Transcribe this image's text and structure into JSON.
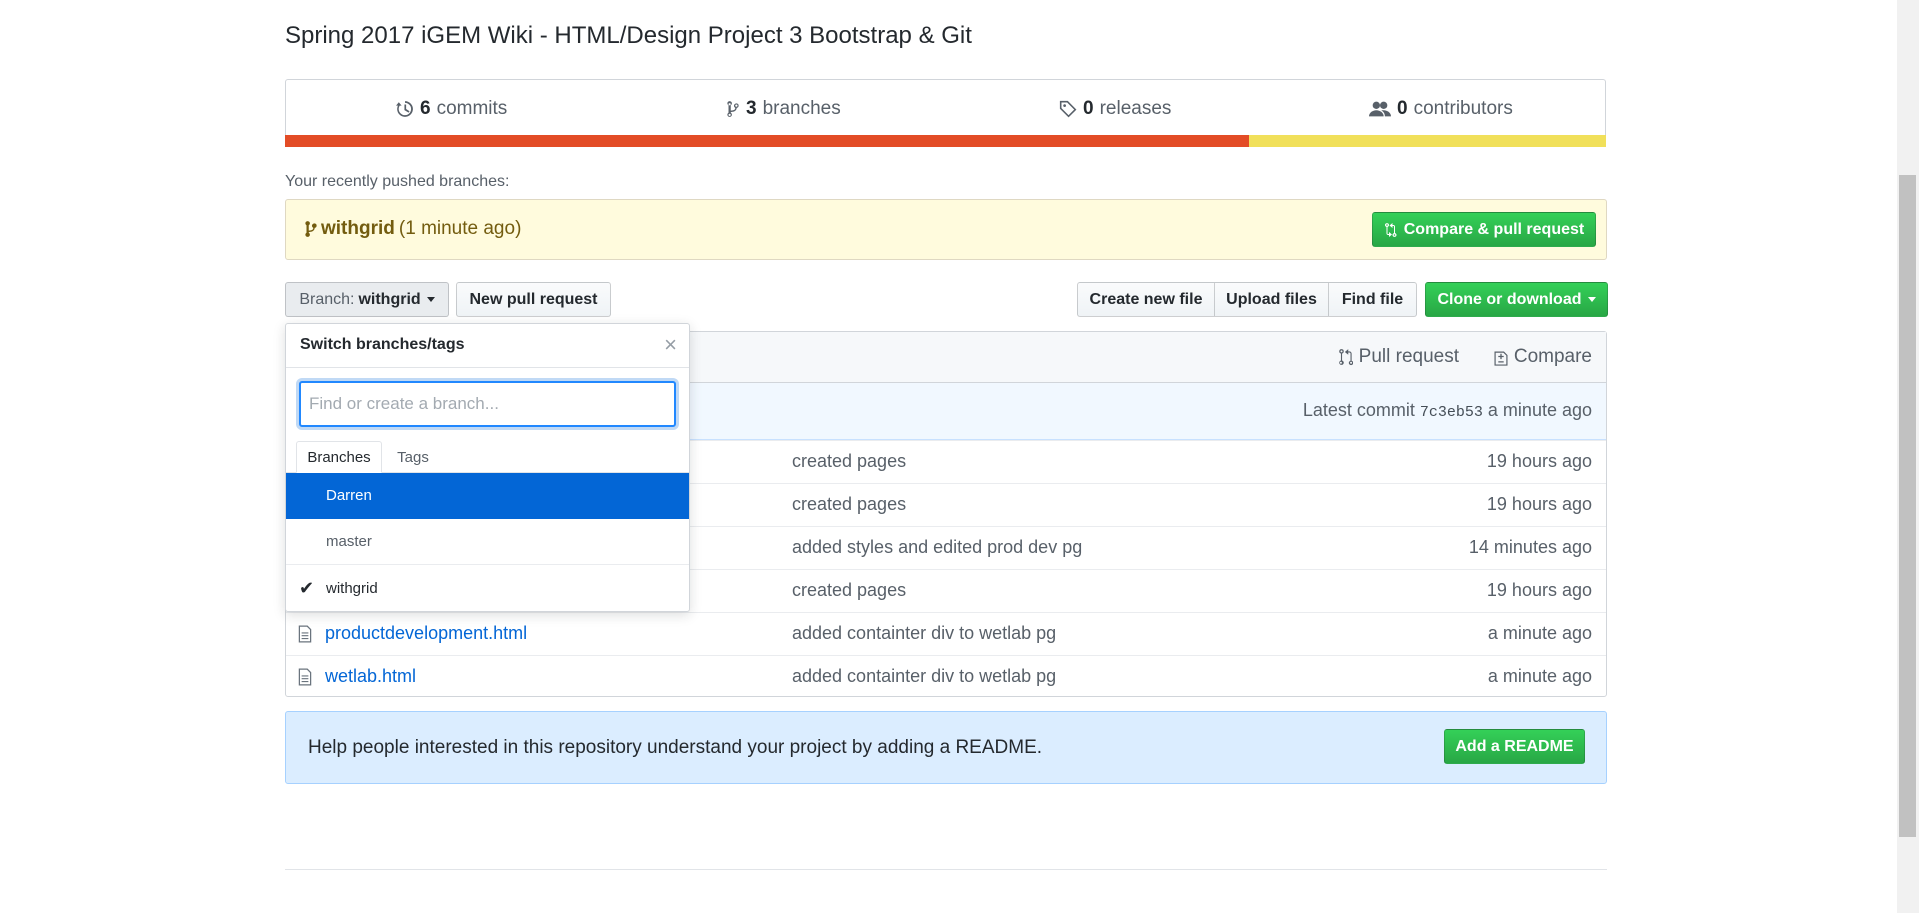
{
  "repo": {
    "description": "Spring 2017 iGEM Wiki - HTML/Design Project 3 Bootstrap & Git"
  },
  "summary": {
    "commits": {
      "count": "6",
      "label": "commits"
    },
    "branches": {
      "count": "3",
      "label": "branches"
    },
    "releases": {
      "count": "0",
      "label": "releases"
    },
    "contributors": {
      "count": "0",
      "label": "contributors"
    },
    "languages": [
      {
        "color": "#e34c26",
        "share": 0.73
      },
      {
        "color": "#f1e05a",
        "share": 0.27
      }
    ]
  },
  "recent": {
    "label": "Your recently pushed branches:",
    "branch": "withgrid",
    "time": "(1 minute ago)",
    "compare_button": "Compare & pull request"
  },
  "toolbar": {
    "branch_prefix": "Branch:",
    "branch_name": "withgrid",
    "new_pr": "New pull request",
    "create_file": "Create new file",
    "upload_files": "Upload files",
    "find_file": "Find file",
    "clone": "Clone or download"
  },
  "header": {
    "pull_request": "Pull request",
    "compare": "Compare",
    "latest_commit_label": "Latest commit",
    "commit_sha": "7c3eb53",
    "commit_time": "a minute ago"
  },
  "files": [
    {
      "name": "",
      "message": "created pages",
      "age": "19 hours ago"
    },
    {
      "name": "",
      "message": "created pages",
      "age": "19 hours ago"
    },
    {
      "name": "",
      "message": "added styles and edited prod dev pg",
      "age": "14 minutes ago"
    },
    {
      "name": "",
      "message": "created pages",
      "age": "19 hours ago"
    },
    {
      "name": "productdevelopment.html",
      "message": "added containter div to wetlab pg",
      "age": "a minute ago"
    },
    {
      "name": "wetlab.html",
      "message": "added containter div to wetlab pg",
      "age": "a minute ago"
    }
  ],
  "readme": {
    "text": "Help people interested in this repository understand your project by adding a README.",
    "button": "Add a README"
  },
  "dropdown": {
    "title": "Switch branches/tags",
    "placeholder": "Find or create a branch...",
    "tabs": [
      "Branches",
      "Tags"
    ],
    "branches": [
      {
        "name": "Darren",
        "selected": false,
        "highlighted": true
      },
      {
        "name": "master",
        "selected": false,
        "highlighted": false
      },
      {
        "name": "withgrid",
        "selected": true,
        "highlighted": false
      }
    ]
  },
  "colors": {
    "accent": "#0366d6",
    "green": "#28a745",
    "highlight": "#0366d6"
  }
}
